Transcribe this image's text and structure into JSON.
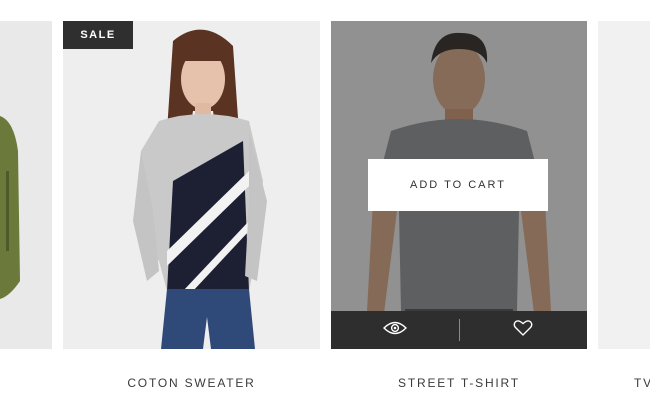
{
  "products": [
    {
      "title": ""
    },
    {
      "title": "COTON SWEATER",
      "badge": "SALE"
    },
    {
      "title": "STREET T-SHIRT",
      "add_to_cart_label": "ADD TO CART"
    },
    {
      "title": "TV"
    }
  ],
  "actions": {
    "quick_view_icon": "eye-icon",
    "wishlist_icon": "heart-icon"
  },
  "colors": {
    "badge_bg": "#2f2f2f",
    "action_bar_bg": "#2e2e2e",
    "overlay": "#282828"
  }
}
